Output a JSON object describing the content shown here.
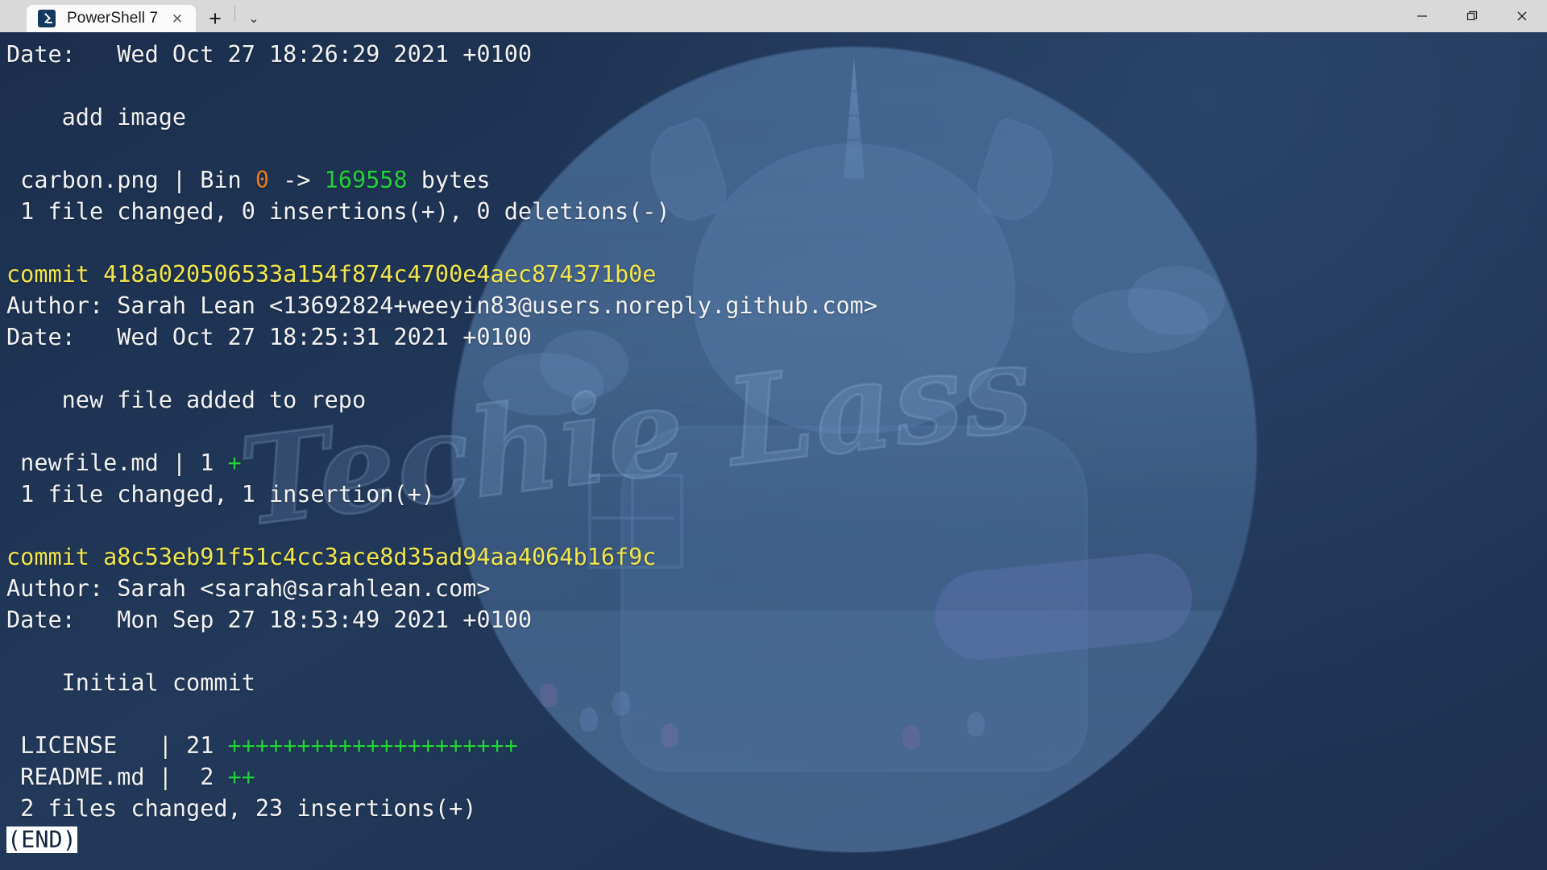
{
  "window": {
    "tab": {
      "title": "PowerShell 7",
      "icon": "powershell-prompt-icon",
      "close_label": "✕"
    },
    "new_tab_label": "+",
    "dropdown_label": "⌄",
    "controls": {
      "minimize": "minimize",
      "restore": "restore",
      "close": "close"
    }
  },
  "background": {
    "watermark_text": "Techie Lass",
    "terminal_bg": "#1f3453",
    "accent_circle": "#3d5f8a"
  },
  "terminal": {
    "prompt_end": "(END)",
    "lines": [
      {
        "segments": [
          {
            "text": "Date:   Wed Oct 27 18:26:29 2021 +0100",
            "color": "default"
          }
        ]
      },
      {
        "segments": [
          {
            "text": "",
            "color": "default"
          }
        ]
      },
      {
        "segments": [
          {
            "text": "    add image",
            "color": "default"
          }
        ]
      },
      {
        "segments": [
          {
            "text": "",
            "color": "default"
          }
        ]
      },
      {
        "segments": [
          {
            "text": " carbon.png | Bin ",
            "color": "default"
          },
          {
            "text": "0",
            "color": "orange"
          },
          {
            "text": " -> ",
            "color": "default"
          },
          {
            "text": "169558",
            "color": "green"
          },
          {
            "text": " bytes",
            "color": "default"
          }
        ]
      },
      {
        "segments": [
          {
            "text": " 1 file changed, 0 insertions(+), 0 deletions(-)",
            "color": "default"
          }
        ]
      },
      {
        "segments": [
          {
            "text": "",
            "color": "default"
          }
        ]
      },
      {
        "segments": [
          {
            "text": "commit 418a020506533a154f874c4700e4aec874371b0e",
            "color": "yellow"
          }
        ]
      },
      {
        "segments": [
          {
            "text": "Author: Sarah Lean <13692824+weeyin83@users.noreply.github.com>",
            "color": "default"
          }
        ]
      },
      {
        "segments": [
          {
            "text": "Date:   Wed Oct 27 18:25:31 2021 +0100",
            "color": "default"
          }
        ]
      },
      {
        "segments": [
          {
            "text": "",
            "color": "default"
          }
        ]
      },
      {
        "segments": [
          {
            "text": "    new file added to repo",
            "color": "default"
          }
        ]
      },
      {
        "segments": [
          {
            "text": "",
            "color": "default"
          }
        ]
      },
      {
        "segments": [
          {
            "text": " newfile.md | 1 ",
            "color": "default"
          },
          {
            "text": "+",
            "color": "green"
          }
        ]
      },
      {
        "segments": [
          {
            "text": " 1 file changed, 1 insertion(+)",
            "color": "default"
          }
        ]
      },
      {
        "segments": [
          {
            "text": "",
            "color": "default"
          }
        ]
      },
      {
        "segments": [
          {
            "text": "commit a8c53eb91f51c4cc3ace8d35ad94aa4064b16f9c",
            "color": "yellow"
          }
        ]
      },
      {
        "segments": [
          {
            "text": "Author: Sarah <sarah@sarahlean.com>",
            "color": "default"
          }
        ]
      },
      {
        "segments": [
          {
            "text": "Date:   Mon Sep 27 18:53:49 2021 +0100",
            "color": "default"
          }
        ]
      },
      {
        "segments": [
          {
            "text": "",
            "color": "default"
          }
        ]
      },
      {
        "segments": [
          {
            "text": "    Initial commit",
            "color": "default"
          }
        ]
      },
      {
        "segments": [
          {
            "text": "",
            "color": "default"
          }
        ]
      },
      {
        "segments": [
          {
            "text": " LICENSE   | 21 ",
            "color": "default"
          },
          {
            "text": "+++++++++++++++++++++",
            "color": "green"
          }
        ]
      },
      {
        "segments": [
          {
            "text": " README.md |  2 ",
            "color": "default"
          },
          {
            "text": "++",
            "color": "green"
          }
        ]
      },
      {
        "segments": [
          {
            "text": " 2 files changed, 23 insertions(+)",
            "color": "default"
          }
        ]
      },
      {
        "segments": [
          {
            "text": "(END)",
            "color": "end"
          }
        ]
      }
    ]
  }
}
